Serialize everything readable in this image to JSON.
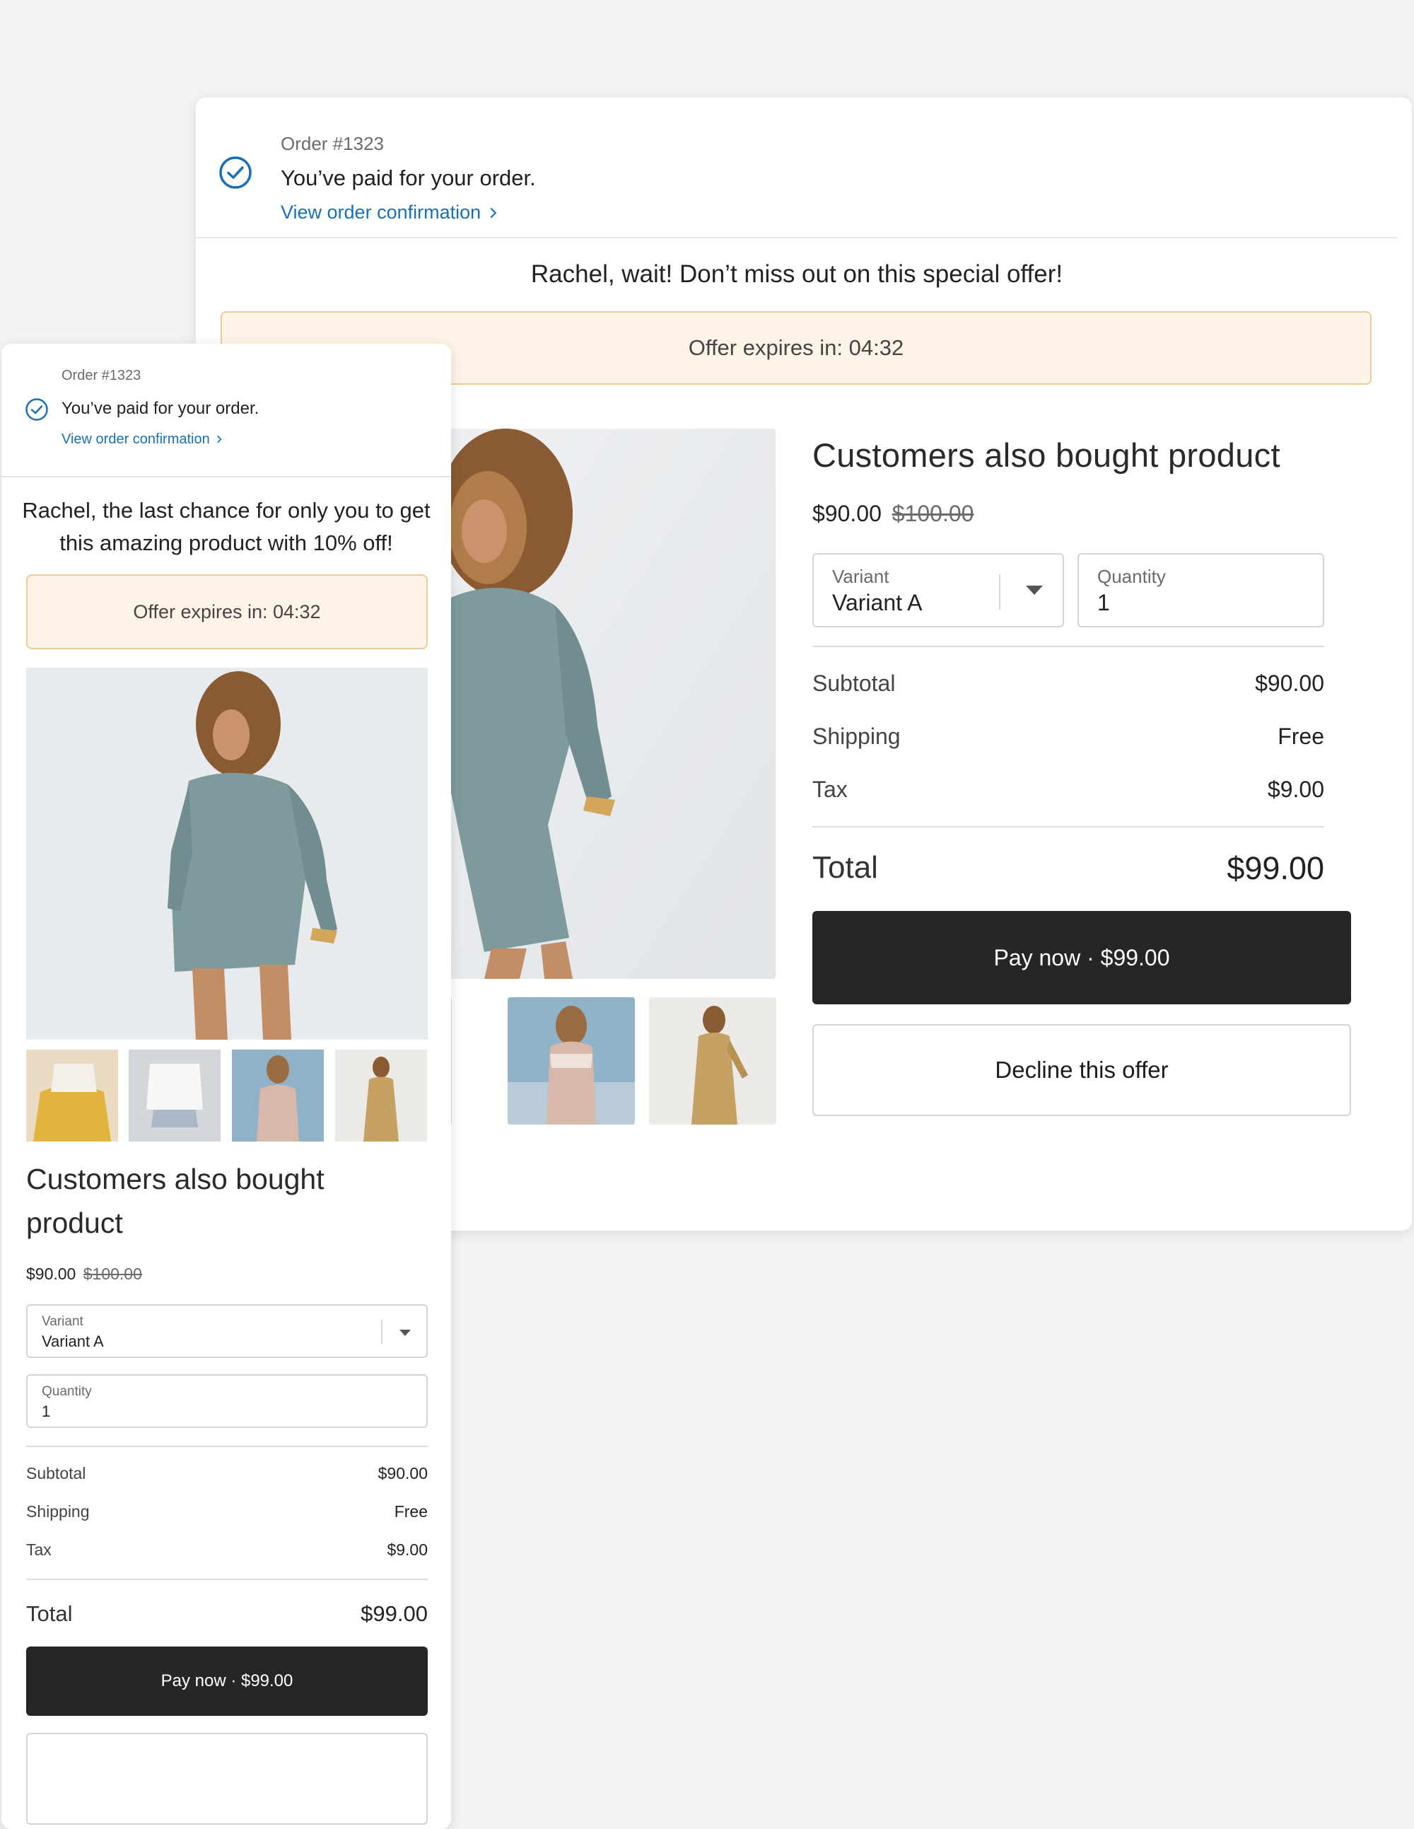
{
  "colors": {
    "background": "#f4f3f1",
    "link": "#1a6fb5",
    "timer_bg": "#fdf3e6",
    "timer_border": "#eccb96",
    "pay_button": "#262626"
  },
  "desktop": {
    "order_number": "Order #1323",
    "paid_message": "You’ve paid for your order.",
    "view_confirmation": "View order confirmation",
    "headline": "Rachel, wait! Don’t miss out on this special offer!",
    "timer": "Offer expires in: 04:32",
    "product_title": "Customers also bought product",
    "price": "$90.00",
    "original_price": "$100.00",
    "variant_label": "Variant",
    "variant_value": "Variant A",
    "quantity_label": "Quantity",
    "quantity_value": "1",
    "subtotal_label": "Subtotal",
    "subtotal_value": "$90.00",
    "shipping_label": "Shipping",
    "shipping_value": "Free",
    "tax_label": "Tax",
    "tax_value": "$9.00",
    "total_label": "Total",
    "total_value": "$99.00",
    "pay_button": "Pay now · $99.00",
    "decline_button": "Decline this offer"
  },
  "mobile": {
    "order_number": "Order #1323",
    "paid_message": "You’ve paid for your order.",
    "view_confirmation": "View order confirmation",
    "headline": "Rachel, the last chance for only you to get this amazing product with 10% off!",
    "timer": "Offer expires in: 04:32",
    "product_title": "Customers also bought product",
    "price": "$90.00",
    "original_price": "$100.00",
    "variant_label": "Variant",
    "variant_value": "Variant A",
    "quantity_label": "Quantity",
    "quantity_value": "1",
    "subtotal_label": "Subtotal",
    "subtotal_value": "$90.00",
    "shipping_label": "Shipping",
    "shipping_value": "Free",
    "tax_label": "Tax",
    "tax_value": "$9.00",
    "total_label": "Total",
    "total_value": "$99.00",
    "pay_button": "Pay now · $99.00"
  },
  "icons": {
    "confirmation": "check-circle-icon",
    "link_arrow": "chevron-right-icon",
    "dropdown": "caret-down-icon"
  }
}
